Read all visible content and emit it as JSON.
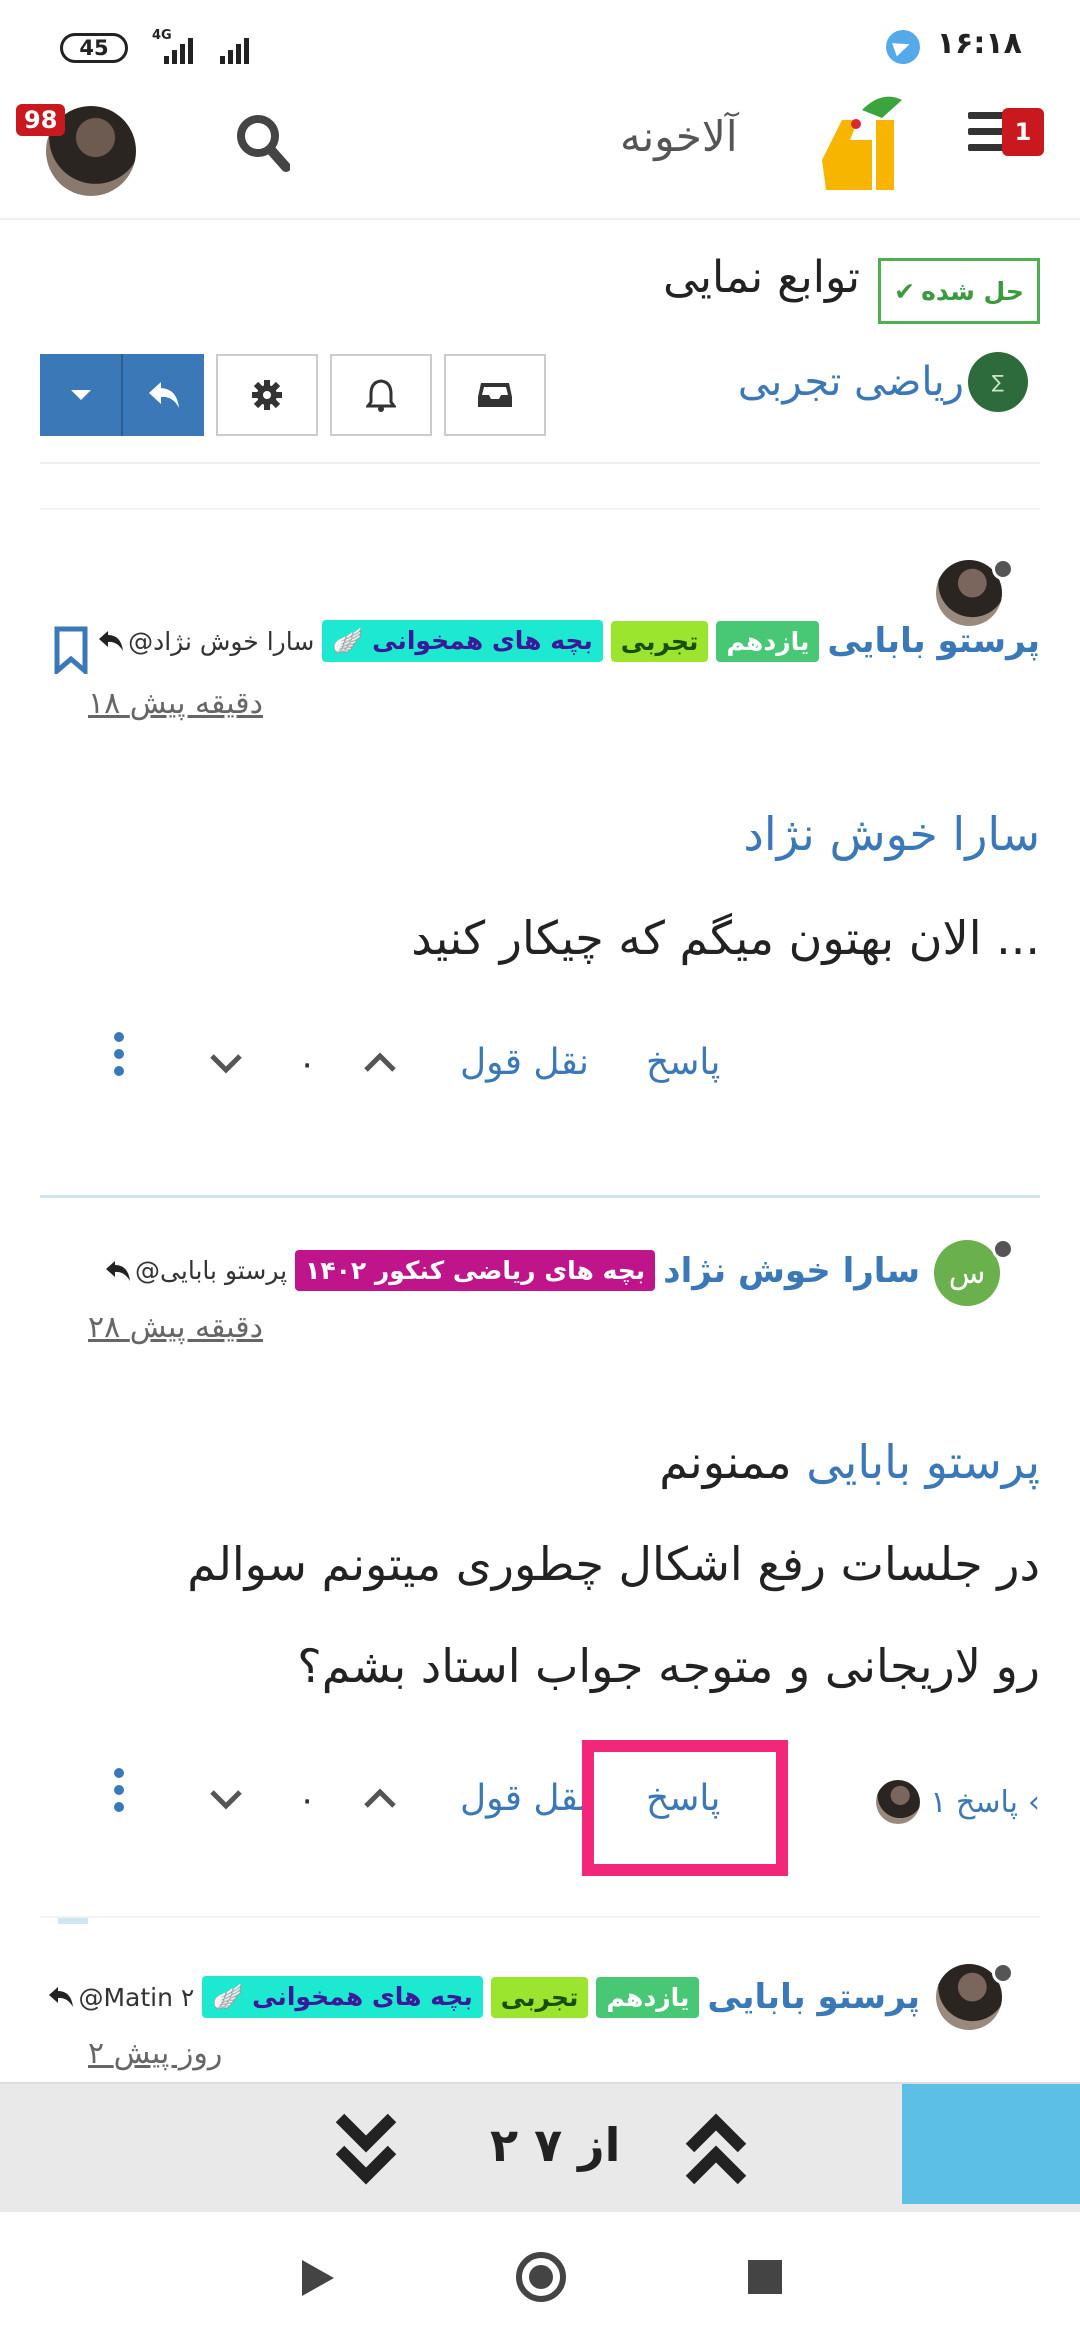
{
  "status_bar": {
    "battery": "45",
    "network": "4G",
    "time": "۱۶:۱۸"
  },
  "header": {
    "brand": "آلاخونه",
    "notifications_count": "98",
    "menu_badge": "1"
  },
  "topic": {
    "solved_label": "حل شده",
    "title": "توابع نمایی",
    "category": "ریاضی تجربی"
  },
  "posts": [
    {
      "author": "پرستو بابایی",
      "tags": [
        "یازدهم",
        "تجربی",
        "بچه های همخوانی"
      ],
      "reply_to": "@سارا خوش نژاد",
      "time": "۱۸ دقیقه پیش",
      "mention": "سارا خوش نژاد",
      "body": "الان بهتون میگم که چیکار کنید ...",
      "actions": {
        "reply": "پاسخ",
        "quote": "نقل قول",
        "votes": "۰"
      }
    },
    {
      "author": "سارا خوش نژاد",
      "avatar_letter": "س",
      "tags": [
        "بچه های ریاضی کنکور ۱۴۰۲"
      ],
      "reply_to": "@پرستو بابایی",
      "time": "۲۸ دقیقه پیش",
      "mention": "پرستو بابایی",
      "mention_suffix": "ممنونم",
      "body_line1": "در جلسات رفع اشکال چطوری میتونم سوالم",
      "body_line2": "رو لاریجانی و متوجه جواب استاد بشم؟",
      "replies_count": "۱ پاسخ",
      "actions": {
        "reply": "پاسخ",
        "quote": "نقل قول",
        "votes": "۰"
      }
    },
    {
      "author": "پرستو بابایی",
      "tags": [
        "یازدهم",
        "تجربی",
        "بچه های همخوانی"
      ],
      "reply_to": "@Matin ۲",
      "time": "۲ روز پیش"
    }
  ],
  "pager": {
    "text": "۲ از ۷"
  },
  "colors": {
    "accent": "#3a78b8",
    "highlight": "#f2277a",
    "solved": "#4caf50"
  }
}
